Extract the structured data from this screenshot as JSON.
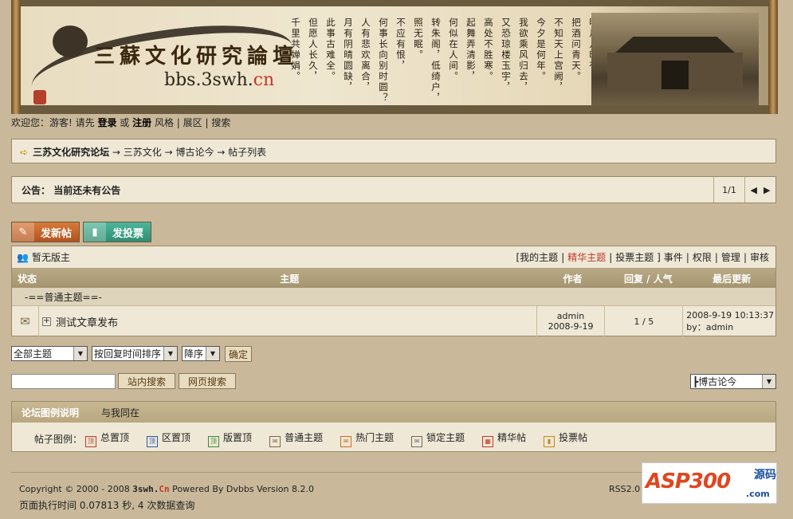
{
  "banner": {
    "title": "三蘇文化研究論壇",
    "domain_prefix": "bbs.3swh.",
    "domain_suffix": "cn",
    "poem_columns": [
      "明月几时有？",
      "把酒问青天。",
      "不知天上宫阙，",
      "今夕是何年。",
      "我欲乘风归去，",
      "又恐琼楼玉宇，",
      "高处不胜寒。",
      "起舞弄清影，",
      "何似在人间。",
      "转朱阁，低绮户，",
      "照无眠。",
      "不应有恨，",
      "何事长向别时圆？",
      "人有悲欢离合，",
      "月有阴晴圆缺，",
      "此事古难全。",
      "但愿人长久，",
      "千里共婵娟。"
    ]
  },
  "topnav": {
    "welcome": "欢迎您：游客!",
    "please": " 请先 ",
    "login": "登录",
    "or": " 或 ",
    "register": "注册",
    "style": " 风格 ",
    "sep1": "|",
    "expand": " 展区 ",
    "sep2": "|",
    "search": " 搜索"
  },
  "breadcrumb": {
    "home": "三苏文化研究论坛",
    "level1": " → 三苏文化",
    "level2": " → 博古论今",
    "level3": " → 帖子列表"
  },
  "notice": {
    "label": "公告：",
    "text": "当前还未有公告",
    "page": "1/1"
  },
  "buttons": {
    "new_post": "发新帖",
    "new_vote": "发投票"
  },
  "topics": {
    "moderator": "暂无版主",
    "links": [
      {
        "label": "[我的主题",
        "active": false
      },
      {
        "label": "|",
        "active": false
      },
      {
        "label": "精华主题",
        "active": true
      },
      {
        "label": "|",
        "active": false
      },
      {
        "label": "投票主题 ]",
        "active": false
      },
      {
        "label": "事件",
        "active": false
      },
      {
        "label": "|",
        "active": false
      },
      {
        "label": "权限",
        "active": false
      },
      {
        "label": "|",
        "active": false
      },
      {
        "label": "管理",
        "active": false
      },
      {
        "label": "|",
        "active": false
      },
      {
        "label": "审核",
        "active": false
      }
    ],
    "columns": {
      "status": "状态",
      "subject": "主题",
      "author": "作者",
      "replies": "回复 / 人气",
      "last": "最后更新"
    },
    "group_label": "-==普通主题==-",
    "rows": [
      {
        "title": "测试文章发布",
        "author": "admin",
        "date": "2008-9-19",
        "stats": "1 / 5",
        "last_time": "2008-9-19 10:13:37",
        "last_by": "by：admin"
      }
    ]
  },
  "filters": {
    "scope": "全部主题",
    "sort": "按回复时间排序",
    "order": "降序",
    "confirm": "确定",
    "search_value": "",
    "site_search": "站内搜索",
    "web_search": "网页搜索",
    "jump": "┣博古论今"
  },
  "legend": {
    "tab1": "论坛图例说明",
    "tab2": "与我同在",
    "prefix": "帖子图例：",
    "items": [
      "总置顶",
      "区置顶",
      "版置顶",
      "普通主题",
      "热门主题",
      "锁定主题",
      "精华帖",
      "投票帖"
    ]
  },
  "footer": {
    "copyright": "Copyright © 2000 - 2008 ",
    "brand": "3swh.",
    "brand_suffix": "Cn",
    "powered": " Powered By Dvbbs Version 8.2.0",
    "exec": "页面执行时间 0.07813 秒, 4 次数据查询",
    "rss": "RSS2.0"
  },
  "logo": {
    "main": "ASP300",
    "cn": "源码",
    "dotcom": ".com"
  },
  "colors": {
    "background": "#c9b99a",
    "panel": "#efe8d6",
    "accent_red": "#c0392b",
    "new_post": "#c0662a",
    "new_vote": "#3aa083"
  }
}
